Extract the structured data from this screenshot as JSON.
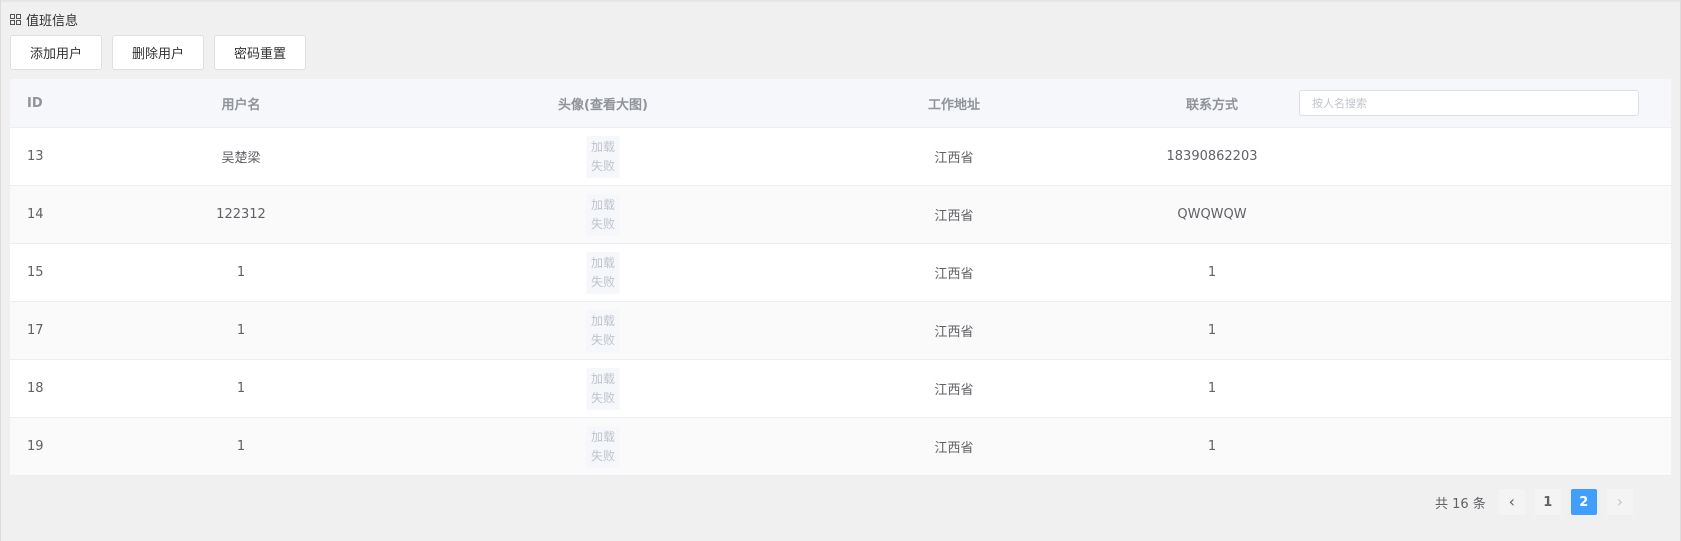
{
  "page": {
    "title": "值班信息"
  },
  "toolbar": {
    "add_label": "添加用户",
    "delete_label": "删除用户",
    "reset_label": "密码重置"
  },
  "table": {
    "headers": {
      "id": "ID",
      "username": "用户名",
      "avatar": "头像(查看大图)",
      "address": "工作地址",
      "contact": "联系方式"
    },
    "search_placeholder": "按人名搜索",
    "load_fail_line1": "加载",
    "load_fail_line2": "失败",
    "rows": [
      {
        "id": "13",
        "username": "吴楚梁",
        "address": "江西省",
        "contact": "18390862203"
      },
      {
        "id": "14",
        "username": "122312",
        "address": "江西省",
        "contact": "QWQWQW"
      },
      {
        "id": "15",
        "username": "1",
        "address": "江西省",
        "contact": "1"
      },
      {
        "id": "17",
        "username": "1",
        "address": "江西省",
        "contact": "1"
      },
      {
        "id": "18",
        "username": "1",
        "address": "江西省",
        "contact": "1"
      },
      {
        "id": "19",
        "username": "1",
        "address": "江西省",
        "contact": "1"
      }
    ]
  },
  "pagination": {
    "total_text": "共 16 条",
    "prev_icon": "chevron-left-icon",
    "next_icon": "chevron-right-icon",
    "pages": [
      "1",
      "2"
    ],
    "current_page": "2"
  },
  "colors": {
    "accent": "#409eff",
    "header_bg": "#f5f7fa",
    "page_bg": "#f0f0f0"
  }
}
